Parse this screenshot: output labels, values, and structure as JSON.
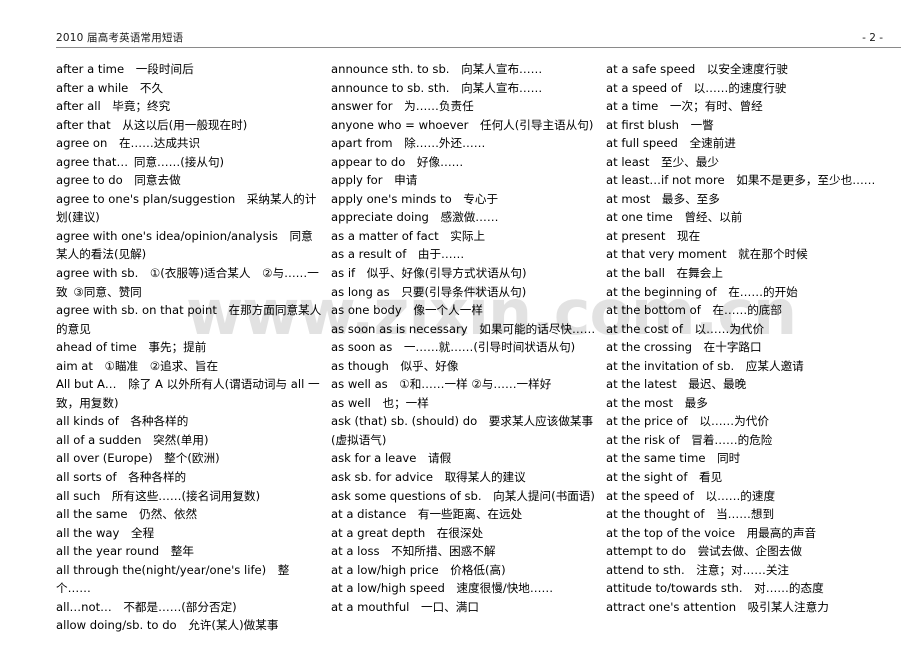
{
  "header": {
    "title": "2010 届高考英语常用短语",
    "page_number": "- 2 -"
  },
  "watermark": {
    "text": "www.zixin.com.cn"
  },
  "columns": [
    {
      "id": "column-1",
      "entries": [
        "after a time 一段时间后",
        "after a while 不久",
        "after all 毕竟；终究",
        "after that 从这以后(用一般现在时)",
        "agree on 在……达成共识",
        "agree that… 同意……(接从句)",
        "agree to do 同意去做",
        "agree to one's plan/suggestion 采纳某人的计划(建议)",
        "agree with one's idea/opinion/analysis 同意某人的看法(见解)",
        "agree with sb. ①(衣服等)适合某人 ②与……一致 ③同意、赞同",
        "agree with sb. on that point 在那方面同意某人的意见",
        "ahead of time 事先；提前",
        "aim at ①瞄准 ②追求、旨在",
        "All but A… 除了 A 以外所有人(谓语动词与 all 一致，用复数)",
        "all kinds of 各种各样的",
        "all of a sudden 突然(单用)",
        "all over (Europe) 整个(欧洲)",
        "all sorts of 各种各样的",
        "all such 所有这些……(接名词用复数)",
        "all the same 仍然、依然",
        "all the way 全程",
        "all the year round 整年",
        "all through the(night/year/one's life) 整个……",
        "all…not… 不都是……(部分否定)",
        "allow doing/sb. to do 允许(某人)做某事"
      ]
    },
    {
      "id": "column-2",
      "entries": [
        "announce sth. to sb. 向某人宣布……",
        "announce to sb. sth. 向某人宣布……",
        "answer for 为……负责任",
        "anyone who = whoever 任何人(引导主语从句)",
        "apart from 除……外还……",
        "appear to do 好像……",
        "apply for 申请",
        "apply one's minds to 专心于",
        "appreciate doing 感激做……",
        "as a matter of fact 实际上",
        "as a result of 由于……",
        "as if 似乎、好像(引导方式状语从句)",
        "as long as 只要(引导条件状语从句)",
        "as one body 像一个人一样",
        "as soon as is necessary 如果可能的话尽快……",
        "as soon as 一……就……(引导时间状语从句)",
        "as though 似乎、好像",
        "as well as ①和……一样 ②与……一样好",
        "as well 也；一样",
        "ask (that) sb. (should) do 要求某人应该做某事(虚拟语气)",
        "ask for a leave 请假",
        "ask sb. for advice 取得某人的建议",
        "ask some questions of sb. 向某人提问(书面语)",
        "at a distance 有一些距离、在远处",
        "at a great depth 在很深处",
        "at a loss 不知所措、困惑不解",
        "at a low/high price 价格低(高)",
        "at a low/high speed 速度很慢/快地……",
        "at a mouthful 一口、满口"
      ]
    },
    {
      "id": "column-3",
      "entries": [
        "at a safe speed 以安全速度行驶",
        "at a speed of 以……的速度行驶",
        "at a time 一次；有时、曾经",
        "at first blush 一瞥",
        "at full speed 全速前进",
        "at least 至少、最少",
        "at least…if not more 如果不是更多，至少也……",
        "at most 最多、至多",
        "at one time 曾经、以前",
        "at present 现在",
        "at that very moment 就在那个时候",
        "at the ball 在舞会上",
        "at the beginning of 在……的开始",
        "at the bottom of 在……的底部",
        "at the cost of 以……为代价",
        "at the crossing 在十字路口",
        "at the invitation of sb. 应某人邀请",
        "at the latest 最迟、最晚",
        "at the most 最多",
        "at the price of 以……为代价",
        "at the risk of 冒着……的危险",
        "at the same time 同时",
        "at the sight of 看见",
        "at the speed of 以……的速度",
        "at the thought of 当……想到",
        "at the top of the voice 用最高的声音",
        "attempt to do 尝试去做、企图去做",
        "attend to sth. 注意；对……关注",
        "attitude to/towards sth. 对……的态度",
        "attract one's attention 吸引某人注意力"
      ]
    }
  ]
}
